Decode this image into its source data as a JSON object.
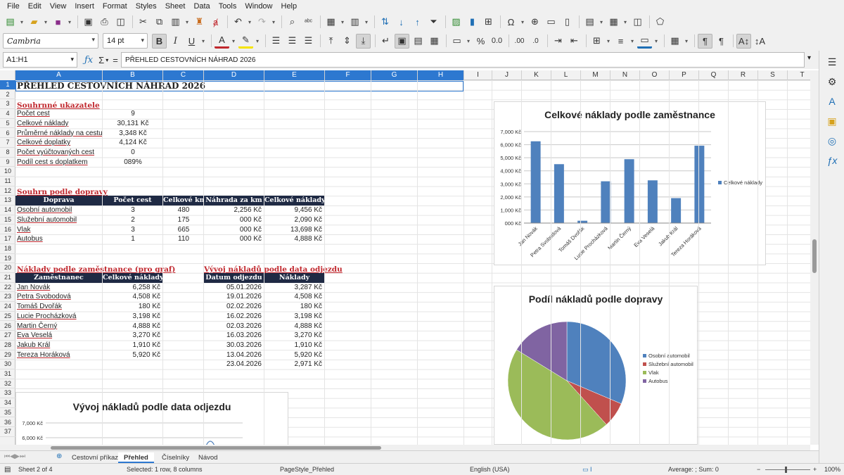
{
  "menubar": {
    "items": [
      "File",
      "Edit",
      "View",
      "Insert",
      "Format",
      "Styles",
      "Sheet",
      "Data",
      "Tools",
      "Window",
      "Help"
    ]
  },
  "toolbar2": {
    "font_name": "Cambria",
    "font_size": "14 pt"
  },
  "formulabar": {
    "cell_ref": "A1:H1",
    "content": "PŘEHLED CESTOVNÍCH NÁHRAD 2026"
  },
  "columns": [
    "A",
    "B",
    "C",
    "D",
    "E",
    "F",
    "G",
    "H",
    "I",
    "J",
    "K",
    "L",
    "M",
    "N",
    "O",
    "P",
    "Q",
    "R",
    "S",
    "T"
  ],
  "rows": [
    "1",
    "2",
    "3",
    "4",
    "5",
    "6",
    "7",
    "8",
    "9",
    "10",
    "11",
    "12",
    "13",
    "14",
    "15",
    "16",
    "17",
    "18",
    "19",
    "20",
    "21",
    "22",
    "23",
    "24",
    "25",
    "26",
    "27",
    "28",
    "29",
    "30",
    "31",
    "32",
    "33",
    "34",
    "35",
    "36",
    "37"
  ],
  "sheet": {
    "title": "PŘEHLED CESTOVNÍCH NÁHRAD 2026",
    "summary": {
      "heading": "Souhrnné ukazatele",
      "rows": [
        [
          "Počet cest",
          "9"
        ],
        [
          "Celkové náklady",
          "30,131 Kč"
        ],
        [
          "Průměrné náklady na cestu",
          "3,348 Kč"
        ],
        [
          "Celkové doplatky",
          "4,124 Kč"
        ],
        [
          "Počet vyúčtovaných cest",
          "0"
        ],
        [
          "Podíl cest s doplatkem",
          "089%"
        ]
      ]
    },
    "transport": {
      "heading": "Souhrn podle dopravy",
      "headers": [
        "Doprava",
        "Počet cest",
        "Celkové km",
        "Náhrada za km",
        "Celkové náklady"
      ],
      "rows": [
        [
          "Osobní automobil",
          "3",
          "480",
          "2,256 Kč",
          "9,456 Kč"
        ],
        [
          "Služební automobil",
          "2",
          "175",
          "000 Kč",
          "2,090 Kč"
        ],
        [
          "Vlak",
          "3",
          "665",
          "000 Kč",
          "13,698 Kč"
        ],
        [
          "Autobus",
          "1",
          "110",
          "000 Kč",
          "4,888 Kč"
        ]
      ]
    },
    "employees": {
      "heading": "Náklady podle zaměstnance (pro graf)",
      "headers": [
        "Zaměstnanec",
        "Celkové náklady"
      ],
      "rows": [
        [
          "Jan Novák",
          "6,258 Kč"
        ],
        [
          "Petra Svobodová",
          "4,508 Kč"
        ],
        [
          "Tomáš Dvořák",
          "180 Kč"
        ],
        [
          "Lucie Procházková",
          "3,198 Kč"
        ],
        [
          "Martin Černý",
          "4,888 Kč"
        ],
        [
          "Eva Veselá",
          "3,270 Kč"
        ],
        [
          "Jakub Král",
          "1,910 Kč"
        ],
        [
          "Tereza Horáková",
          "5,920 Kč"
        ]
      ]
    },
    "dates": {
      "heading": "Vývoj nákladů podle data odjezdu",
      "headers": [
        "Datum odjezdu",
        "Náklady"
      ],
      "rows": [
        [
          "05.01.2026",
          "3,287 Kč"
        ],
        [
          "19.01.2026",
          "4,508 Kč"
        ],
        [
          "02.02.2026",
          "180 Kč"
        ],
        [
          "16.02.2026",
          "3,198 Kč"
        ],
        [
          "02.03.2026",
          "4,888 Kč"
        ],
        [
          "16.03.2026",
          "3,270 Kč"
        ],
        [
          "30.03.2026",
          "1,910 Kč"
        ],
        [
          "13.04.2026",
          "5,920 Kč"
        ],
        [
          "23.04.2026",
          "2,971 Kč"
        ]
      ]
    }
  },
  "chart_data": [
    {
      "type": "bar",
      "title": "Celkové náklady podle zaměstnance",
      "categories": [
        "Jan Novák",
        "Petra Svobodová",
        "Tomáš Dvořák",
        "Lucie Procházková",
        "Martin Černý",
        "Eva Veselá",
        "Jakub Král",
        "Tereza Horáková"
      ],
      "series": [
        {
          "name": "Celkové náklady",
          "values": [
            6258,
            4508,
            180,
            3198,
            4888,
            3270,
            1910,
            5920
          ]
        }
      ],
      "ylim": [
        0,
        7000
      ],
      "yticks": [
        "000 Kč",
        "1,000 Kč",
        "2,000 Kč",
        "3,000 Kč",
        "4,000 Kč",
        "5,000 Kč",
        "6,000 Kč",
        "7,000 Kč"
      ],
      "legend": "right",
      "color": "#4f81bd"
    },
    {
      "type": "pie",
      "title": "Podíl nákladů podle dopravy",
      "categories": [
        "Osobní automobil",
        "Služební automobil",
        "Vlak",
        "Autobus"
      ],
      "values": [
        9456,
        2090,
        13698,
        4888
      ],
      "colors": [
        "#4f81bd",
        "#c0504d",
        "#9bbb59",
        "#8064a2"
      ],
      "legend": "right"
    },
    {
      "type": "line",
      "title": "Vývoj nákladů podle data odjezdu",
      "yticks": [
        "7,000 Kč",
        "6,000 Kč"
      ],
      "color": "#4f81bd"
    }
  ],
  "tabs": [
    "Cestovní příkazy",
    "Přehled",
    "Číselníky",
    "Návod"
  ],
  "statusbar": {
    "sheet": "Sheet 2 of 4",
    "selection": "Selected: 1 row, 8 columns",
    "pagestyle": "PageStyle_Přehled",
    "language": "English (USA)",
    "summary": "Average: ; Sum: 0",
    "zoom": "100%"
  }
}
